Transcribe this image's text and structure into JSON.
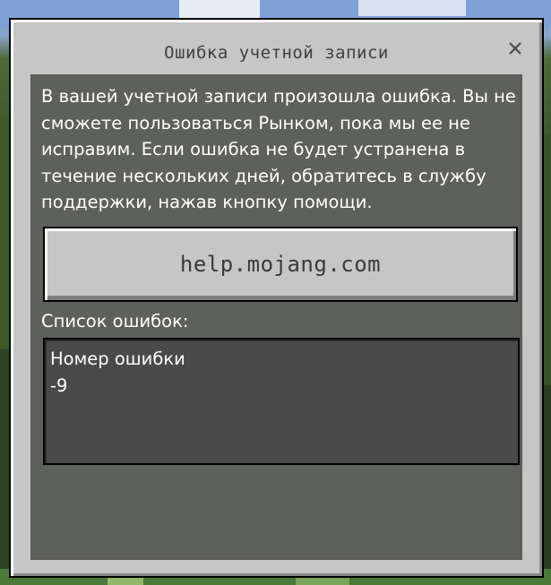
{
  "dialog": {
    "title": "Ошибка учетной записи",
    "close_icon": "close-icon",
    "message": "В вашей учетной записи произошла ошибка. Вы не сможете пользоваться Рынком, пока мы ее не исправим. Если ошибка не будет устранена в течение нескольких дней, обратитесь в службу поддержки, нажав кнопку помощи.",
    "help_button_label": "help.mojang.com",
    "errors_label": "Список ошибок:",
    "errors": {
      "title": "Номер ошибки",
      "code": "-9"
    }
  },
  "colors": {
    "dialog_bg": "#c6c6c6",
    "panel_bg": "#1e221a",
    "errors_box_bg": "#4a4a4a",
    "text_light": "#ffffff",
    "text_dark": "#3f3f3f"
  }
}
